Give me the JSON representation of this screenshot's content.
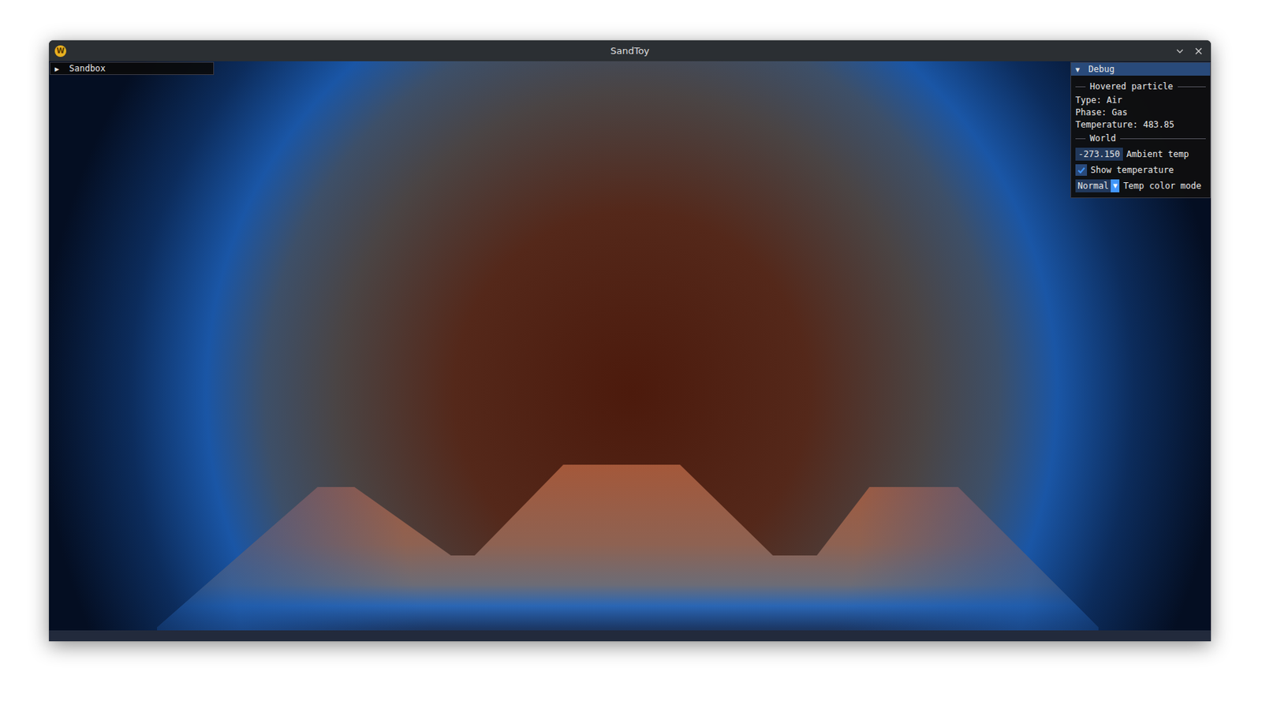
{
  "window": {
    "title": "SandToy",
    "app_icon": "W"
  },
  "sandbox_panel": {
    "arrow": "▶",
    "title": "Sandbox",
    "expanded": false
  },
  "debug_panel": {
    "arrow": "▼",
    "title": "Debug",
    "expanded": true,
    "rows": [
      {
        "kind": "separator",
        "text": "Hovered particle"
      },
      {
        "kind": "text",
        "text": "Type: Air"
      },
      {
        "kind": "text",
        "text": "Phase: Gas"
      },
      {
        "kind": "text",
        "text": "Temperature: 483.85"
      },
      {
        "kind": "separator",
        "text": "World"
      },
      {
        "kind": "input",
        "value": "-273.150",
        "label": "Ambient temp"
      },
      {
        "kind": "checkbox",
        "checked": true,
        "label": "Show temperature"
      },
      {
        "kind": "combo",
        "value": "Normal",
        "arrow": "▼",
        "label": "Temp color mode"
      }
    ]
  }
}
